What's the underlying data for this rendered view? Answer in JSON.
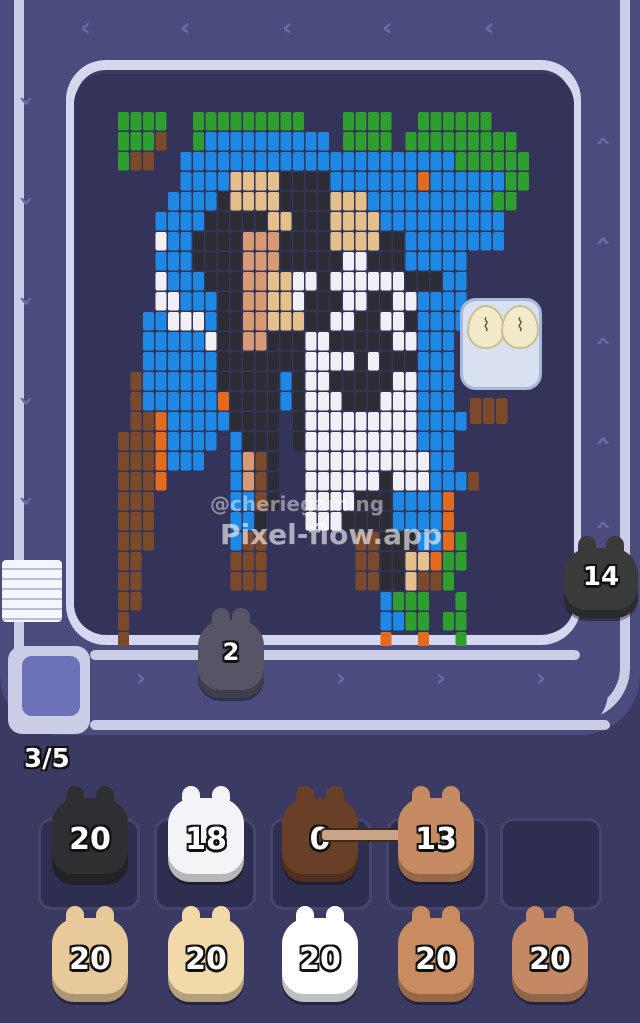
{
  "game": {
    "watermark_handle": "@cheriegaming",
    "watermark_site": "Pixel-flow.app",
    "progress": "3/5",
    "conveyor_shooters": [
      {
        "count": "14",
        "color": "#3a3a3a"
      },
      {
        "count": "2",
        "color": "#555566"
      }
    ],
    "slot_row": [
      {
        "count": "20",
        "color": "#2f2f33"
      },
      {
        "count": "18",
        "color": "#f4f4f8"
      },
      {
        "count": "0",
        "color": "#6a3f28"
      },
      {
        "count": "13",
        "color": "#c78b63"
      },
      {
        "count": "",
        "color": "empty"
      }
    ],
    "queue_row": [
      {
        "count": "20",
        "color": "#e8c99a"
      },
      {
        "count": "20",
        "color": "#f1d9a8"
      },
      {
        "count": "20",
        "color": "#ffffff"
      },
      {
        "count": "20",
        "color": "#c98b60"
      },
      {
        "count": "20",
        "color": "#c48865"
      }
    ]
  },
  "colors": {
    "background": "#3a3a63",
    "track": "#4b4b7e",
    "rail": "#c9cde6",
    "blue": "#1e88e5",
    "green": "#2e9e2e",
    "black": "#2c2c34",
    "white": "#f0f0f4",
    "tan": "#e6c08a",
    "brown": "#7a4a2a",
    "orange": "#e46a1e",
    "skin": "#d79a72"
  }
}
